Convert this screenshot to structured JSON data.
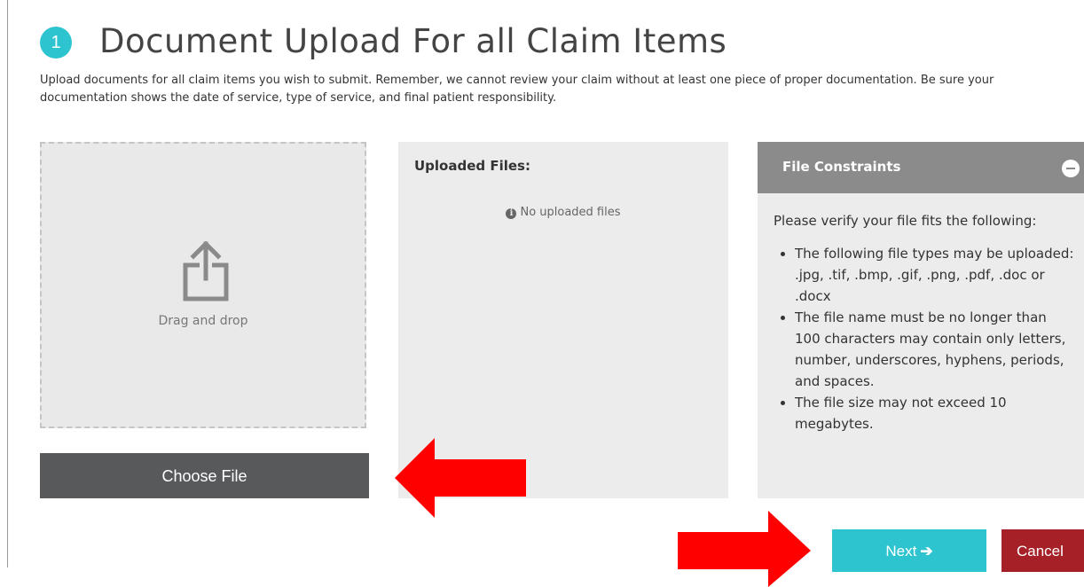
{
  "step": {
    "number": "1"
  },
  "page_title": "Document Upload For all Claim Items",
  "intro_text": "Upload documents for all claim items you wish to submit. Remember, we cannot review your claim without at least one piece of proper documentation. Be sure your documentation shows the date of service, type of service, and final patient responsibility.",
  "dropzone": {
    "label": "Drag and drop",
    "icon": "upload-share-icon"
  },
  "choose_file_label": "Choose File",
  "uploaded": {
    "title": "Uploaded Files:",
    "empty_message": "No uploaded files",
    "empty_icon": "info-circle-icon"
  },
  "constraints": {
    "title": "File Constraints",
    "toggle_icon": "minus-circle-icon",
    "intro": "Please verify your file fits the following:",
    "items": [
      "The following file types may be uploaded: .jpg, .tif, .bmp, .gif, .png, .pdf, .doc or .docx",
      "The file name must be no longer than 100 characters may contain only letters, number, underscores, hyphens, periods, and spaces.",
      "The file size may not exceed 10 megabytes."
    ]
  },
  "actions": {
    "next_label": "Next",
    "next_icon": "arrow-right-icon",
    "cancel_label": "Cancel"
  },
  "colors": {
    "accent": "#2ec4cf",
    "dark_button": "#58595b",
    "cancel": "#a52027",
    "panel_header": "#8b8b8b",
    "panel_bg": "#ececec",
    "annotation_arrow": "#ff0000"
  }
}
